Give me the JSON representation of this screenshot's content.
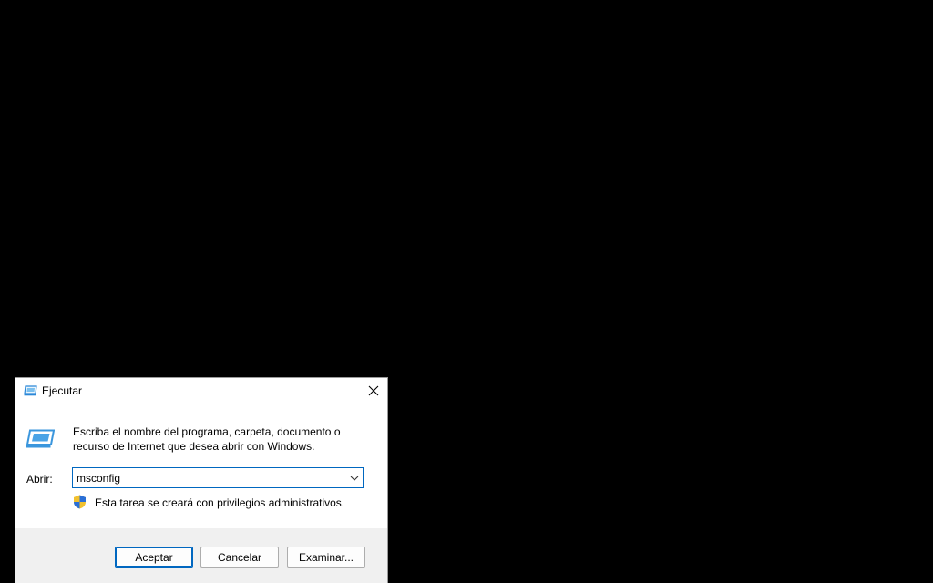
{
  "dialog": {
    "title": "Ejecutar",
    "title_icon": "run-dialog-icon",
    "close_icon": "close-icon",
    "main_icon": "run-program-icon",
    "description": "Escriba el nombre del programa, carpeta, documento o recurso de Internet que desea abrir con Windows.",
    "open_label": "Abrir:",
    "open_value": "msconfig",
    "dropdown_icon": "chevron-down-icon",
    "shield_icon": "uac-shield-icon",
    "admin_note": "Esta tarea se creará con privilegios administrativos.",
    "buttons": {
      "ok": "Aceptar",
      "cancel": "Cancelar",
      "browse": "Examinar..."
    }
  },
  "colors": {
    "desktop_background": "#000000",
    "dialog_background": "#ffffff",
    "footer_background": "#f0f0f0",
    "accent": "#0067c0",
    "run_icon_blue": "#3a96dd"
  }
}
